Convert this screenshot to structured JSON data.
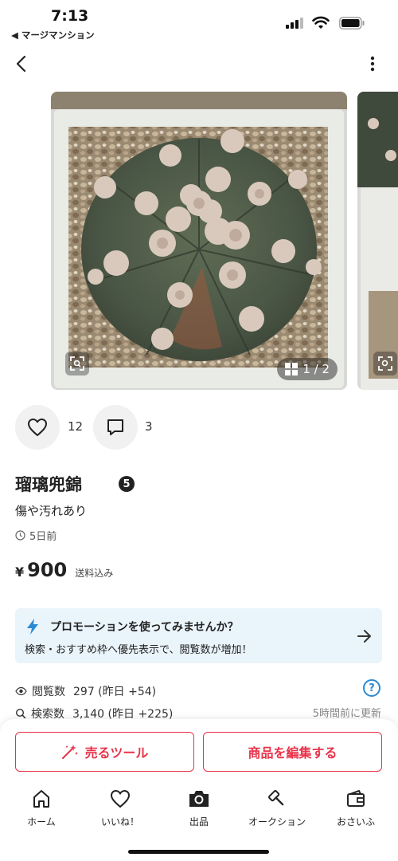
{
  "status": {
    "time": "7:13",
    "back_app": "◀ マージマンション"
  },
  "photos": {
    "counter": "1 / 2"
  },
  "social": {
    "likes": "12",
    "comments": "3"
  },
  "item": {
    "title": "瑠璃兜錦",
    "condition_badge": "5",
    "condition": "傷や汚れあり",
    "posted": "5日前",
    "currency": "¥",
    "price": "900",
    "shipping": "送料込み"
  },
  "promo": {
    "title": "プロモーションを使ってみませんか？",
    "subtitle": "検索・おすすめ枠へ優先表示で、閲覧数が増加！"
  },
  "stats": {
    "views_label": "閲覧数",
    "views_value": "297 (昨日 +54)",
    "search_label": "検索数",
    "search_value": "3,140 (昨日 +225)",
    "updated": "5時間前に更新"
  },
  "actions": {
    "sell_tool": "売るツール",
    "edit_item": "商品を編集する"
  },
  "tabs": [
    {
      "label": "ホーム",
      "icon": "home-icon"
    },
    {
      "label": "いいね！",
      "icon": "heart-icon"
    },
    {
      "label": "出品",
      "icon": "camera-icon"
    },
    {
      "label": "オークション",
      "icon": "gavel-icon"
    },
    {
      "label": "おさいふ",
      "icon": "wallet-icon"
    }
  ],
  "colors": {
    "accent": "#e8334a",
    "promo_bg": "#eaf4fb",
    "promo_icon": "#2a8ad4"
  }
}
